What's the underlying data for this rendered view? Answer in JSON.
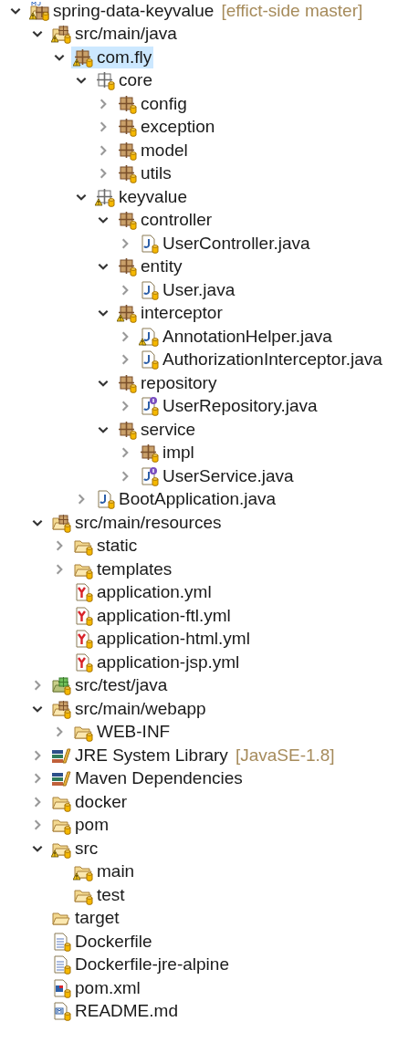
{
  "tree": [
    {
      "label": "spring-data-keyvalue",
      "suffix": "[effict-side master]",
      "kind": "project",
      "expanded": true,
      "selected": false,
      "warning": true,
      "tracked": true,
      "children": [
        {
          "label": "src/main/java",
          "kind": "source-folder",
          "expanded": true,
          "selected": false,
          "warning": true,
          "tracked": true,
          "children": [
            {
              "label": "com.fly",
              "kind": "package",
              "expanded": true,
              "selected": true,
              "warning": true,
              "tracked": true,
              "children": [
                {
                  "label": "core",
                  "kind": "package-empty",
                  "expanded": true,
                  "selected": false,
                  "warning": false,
                  "tracked": true,
                  "children": [
                    {
                      "label": "config",
                      "kind": "package",
                      "expanded": false,
                      "selected": false,
                      "warning": false,
                      "tracked": true
                    },
                    {
                      "label": "exception",
                      "kind": "package",
                      "expanded": false,
                      "selected": false,
                      "warning": false,
                      "tracked": true
                    },
                    {
                      "label": "model",
                      "kind": "package",
                      "expanded": false,
                      "selected": false,
                      "warning": false,
                      "tracked": true
                    },
                    {
                      "label": "utils",
                      "kind": "package",
                      "expanded": false,
                      "selected": false,
                      "warning": false,
                      "tracked": true
                    }
                  ]
                },
                {
                  "label": "keyvalue",
                  "kind": "package-empty",
                  "expanded": true,
                  "selected": false,
                  "warning": true,
                  "tracked": true,
                  "children": [
                    {
                      "label": "controller",
                      "kind": "package",
                      "expanded": true,
                      "selected": false,
                      "warning": false,
                      "tracked": true,
                      "children": [
                        {
                          "label": "UserController.java",
                          "kind": "java-class",
                          "expanded": false,
                          "selected": false,
                          "warning": false,
                          "tracked": true
                        }
                      ]
                    },
                    {
                      "label": "entity",
                      "kind": "package",
                      "expanded": true,
                      "selected": false,
                      "warning": false,
                      "tracked": true,
                      "children": [
                        {
                          "label": "User.java",
                          "kind": "java-class",
                          "expanded": false,
                          "selected": false,
                          "warning": false,
                          "tracked": true
                        }
                      ]
                    },
                    {
                      "label": "interceptor",
                      "kind": "package",
                      "expanded": true,
                      "selected": false,
                      "warning": true,
                      "tracked": true,
                      "children": [
                        {
                          "label": "AnnotationHelper.java",
                          "kind": "java-class",
                          "expanded": false,
                          "selected": false,
                          "warning": true,
                          "tracked": true
                        },
                        {
                          "label": "AuthorizationInterceptor.java",
                          "kind": "java-class",
                          "expanded": false,
                          "selected": false,
                          "warning": false,
                          "tracked": true
                        }
                      ]
                    },
                    {
                      "label": "repository",
                      "kind": "package",
                      "expanded": true,
                      "selected": false,
                      "warning": false,
                      "tracked": true,
                      "children": [
                        {
                          "label": "UserRepository.java",
                          "kind": "java-interface",
                          "expanded": false,
                          "selected": false,
                          "warning": false,
                          "tracked": true
                        }
                      ]
                    },
                    {
                      "label": "service",
                      "kind": "package",
                      "expanded": true,
                      "selected": false,
                      "warning": false,
                      "tracked": true,
                      "children": [
                        {
                          "label": "impl",
                          "kind": "package",
                          "expanded": false,
                          "selected": false,
                          "warning": false,
                          "tracked": true
                        },
                        {
                          "label": "UserService.java",
                          "kind": "java-interface",
                          "expanded": false,
                          "selected": false,
                          "warning": false,
                          "tracked": true
                        }
                      ]
                    }
                  ]
                },
                {
                  "label": "BootApplication.java",
                  "kind": "java-class",
                  "expanded": false,
                  "selected": false,
                  "warning": false,
                  "tracked": true
                }
              ]
            }
          ]
        },
        {
          "label": "src/main/resources",
          "kind": "resource-folder",
          "expanded": true,
          "selected": false,
          "warning": false,
          "tracked": true,
          "children": [
            {
              "label": "static",
              "kind": "folder",
              "expanded": false,
              "selected": false,
              "warning": false,
              "tracked": true
            },
            {
              "label": "templates",
              "kind": "folder",
              "expanded": false,
              "selected": false,
              "warning": false,
              "tracked": true
            },
            {
              "label": "application.yml",
              "kind": "yaml",
              "selected": false,
              "warning": false,
              "tracked": true
            },
            {
              "label": "application-ftl.yml",
              "kind": "yaml",
              "selected": false,
              "warning": false,
              "tracked": true
            },
            {
              "label": "application-html.yml",
              "kind": "yaml",
              "selected": false,
              "warning": false,
              "tracked": true
            },
            {
              "label": "application-jsp.yml",
              "kind": "yaml",
              "selected": false,
              "warning": false,
              "tracked": true
            }
          ]
        },
        {
          "label": "src/test/java",
          "kind": "test-source-folder",
          "expanded": false,
          "selected": false,
          "warning": false,
          "tracked": true
        },
        {
          "label": "src/main/webapp",
          "kind": "resource-folder",
          "expanded": true,
          "selected": false,
          "warning": false,
          "tracked": true,
          "children": [
            {
              "label": "WEB-INF",
              "kind": "folder",
              "expanded": false,
              "selected": false,
              "warning": false,
              "tracked": true
            }
          ]
        },
        {
          "label": "JRE System Library",
          "suffix": "[JavaSE-1.8]",
          "kind": "library",
          "expanded": false,
          "selected": false,
          "warning": false,
          "tracked": false
        },
        {
          "label": "Maven Dependencies",
          "kind": "library",
          "expanded": false,
          "selected": false,
          "warning": false,
          "tracked": false
        },
        {
          "label": "docker",
          "kind": "folder",
          "expanded": false,
          "selected": false,
          "warning": false,
          "tracked": true
        },
        {
          "label": "pom",
          "kind": "folder",
          "expanded": false,
          "selected": false,
          "warning": false,
          "tracked": true
        },
        {
          "label": "src",
          "kind": "folder",
          "expanded": true,
          "selected": false,
          "warning": true,
          "tracked": true,
          "children": [
            {
              "label": "main",
              "kind": "folder",
              "selected": false,
              "warning": true,
              "tracked": true
            },
            {
              "label": "test",
              "kind": "folder",
              "selected": false,
              "warning": false,
              "tracked": true
            }
          ]
        },
        {
          "label": "target",
          "kind": "folder",
          "selected": false,
          "warning": false,
          "tracked": false
        },
        {
          "label": "Dockerfile",
          "kind": "text-file",
          "selected": false,
          "warning": false,
          "tracked": true
        },
        {
          "label": "Dockerfile-jre-alpine",
          "kind": "text-file",
          "selected": false,
          "warning": false,
          "tracked": true
        },
        {
          "label": "pom.xml",
          "kind": "maven-file",
          "selected": false,
          "warning": false,
          "tracked": true
        },
        {
          "label": "README.md",
          "kind": "markdown-file",
          "selected": false,
          "warning": false,
          "tracked": true
        }
      ]
    }
  ]
}
